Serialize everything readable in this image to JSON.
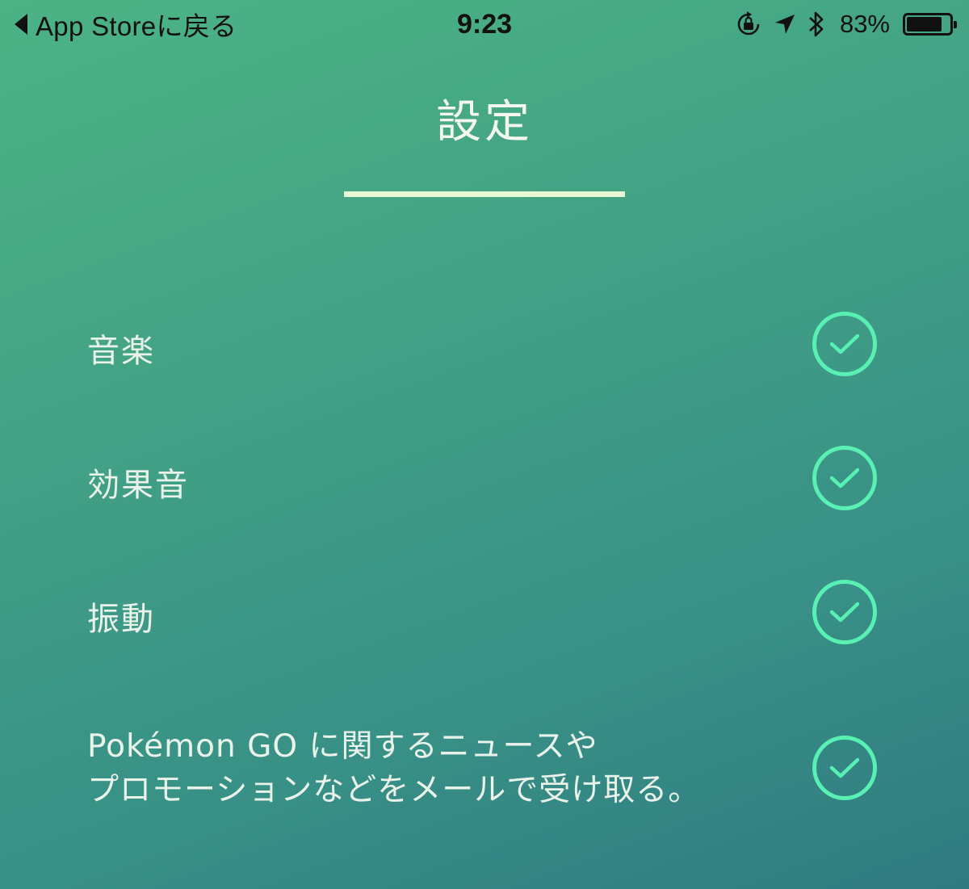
{
  "status_bar": {
    "back_label": "App Storeに戻る",
    "time": "9:23",
    "battery_percent": "83%",
    "battery_level": 0.83,
    "icons": [
      "orientation-lock-icon",
      "location-arrow-icon",
      "bluetooth-icon",
      "battery-icon"
    ]
  },
  "page": {
    "title": "設定"
  },
  "settings": [
    {
      "label": "音楽",
      "checked": true
    },
    {
      "label": "効果音",
      "checked": true
    },
    {
      "label": "振動",
      "checked": true
    },
    {
      "label_line1": "Pokémon GO に関するニュースや",
      "label_line2": "プロモーションなどをメールで受け取る。",
      "checked": true
    }
  ],
  "colors": {
    "accent": "#58f0b3",
    "underline": "#e7f8d5",
    "text": "#eaf3ea",
    "bg_top": "#4cb385",
    "bg_bottom": "#2f7a80"
  }
}
